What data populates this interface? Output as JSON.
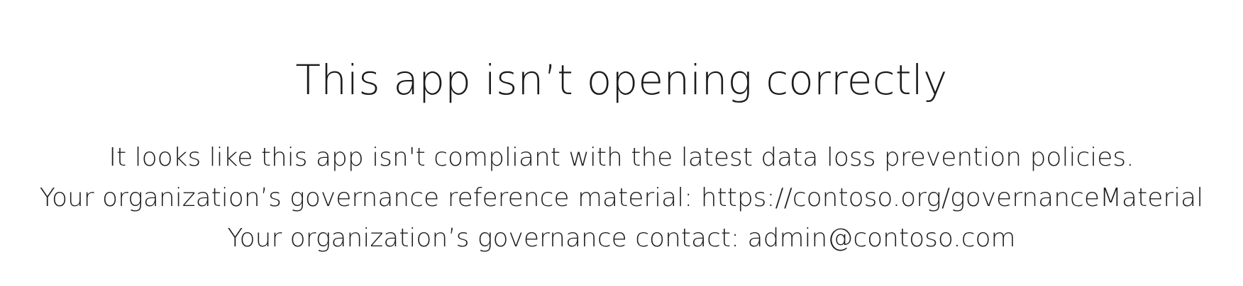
{
  "error": {
    "title": "This app isn’t opening correctly",
    "lines": [
      "It looks like this app isn't compliant with the latest data loss prevention policies.",
      "Your organization’s governance reference material: https://contoso.org/governanceMaterial",
      "Your organization’s governance contact: admin@contoso.com"
    ]
  },
  "colors": {
    "background": "#ffffff",
    "text": "#1f1f1f"
  }
}
